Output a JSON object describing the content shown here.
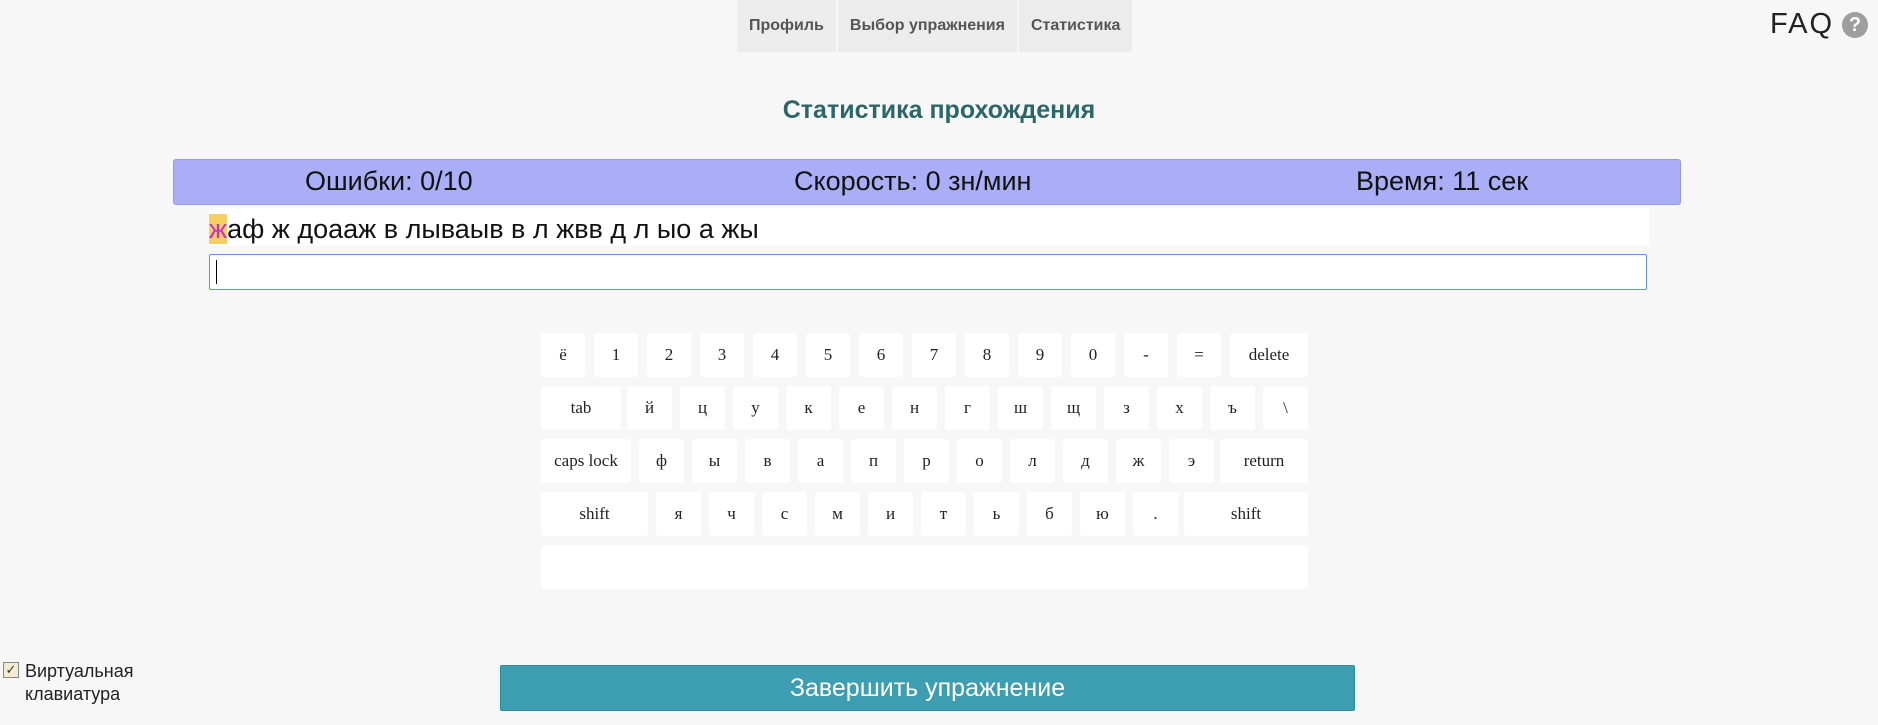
{
  "nav": {
    "tabs": [
      {
        "label": "Профиль"
      },
      {
        "label": "Выбор упражнения"
      },
      {
        "label": "Статистика"
      }
    ]
  },
  "faq": {
    "label": "FAQ",
    "icon": "help-icon",
    "icon_glyph": "?"
  },
  "page_title": "Статистика прохождения",
  "stats": {
    "errors": "Ошибки: 0/10",
    "speed": "Скорость: 0 зн/мин",
    "time": "Время: 11 сек"
  },
  "exercise": {
    "current_char": "ж",
    "remaining_text": "аф ж доааж в лываыв в л жвв д л ыо а жы"
  },
  "input": {
    "value": ""
  },
  "keyboard": {
    "rows": [
      [
        "ё",
        "1",
        "2",
        "3",
        "4",
        "5",
        "6",
        "7",
        "8",
        "9",
        "0",
        "-",
        "=",
        "delete"
      ],
      [
        "tab",
        "й",
        "ц",
        "у",
        "к",
        "е",
        "н",
        "г",
        "ш",
        "щ",
        "з",
        "х",
        "ъ",
        "\\"
      ],
      [
        "caps lock",
        "ф",
        "ы",
        "в",
        "а",
        "п",
        "р",
        "о",
        "л",
        "д",
        "ж",
        "э",
        "return"
      ],
      [
        "shift",
        "я",
        "ч",
        "с",
        "м",
        "и",
        "т",
        "ь",
        "б",
        "ю",
        ".",
        "shift"
      ],
      [
        ""
      ]
    ]
  },
  "virtual_keyboard": {
    "label": "Виртуальная клавиатура",
    "checked": true
  },
  "finish_button": {
    "label": "Завершить упражнение"
  },
  "colors": {
    "stats_bg": "#aaaef6",
    "title": "#2c6669",
    "button": "#3d9db1",
    "highlight": "#f5cf60"
  }
}
